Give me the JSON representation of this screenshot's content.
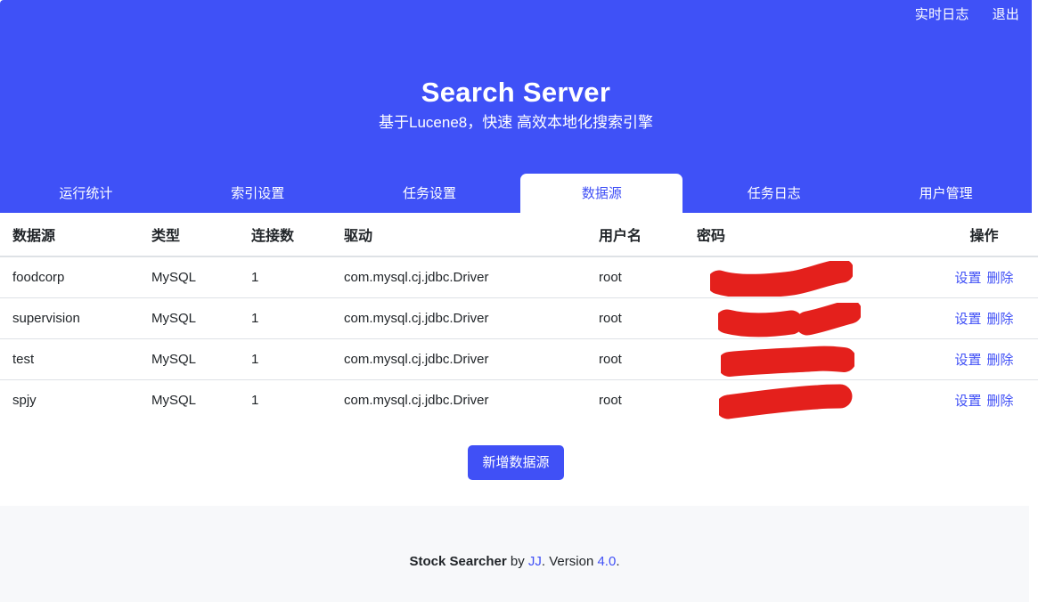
{
  "header": {
    "title": "Search Server",
    "subtitle": "基于Lucene8，快速 高效本地化搜索引擎",
    "accent_color": "#3f51f7",
    "topnav": [
      {
        "label": "实时日志",
        "name": "realtime-log"
      },
      {
        "label": "退出",
        "name": "logout"
      }
    ]
  },
  "tabs": [
    {
      "label": "运行统计",
      "name": "run-stats",
      "active": false
    },
    {
      "label": "索引设置",
      "name": "index-settings",
      "active": false
    },
    {
      "label": "任务设置",
      "name": "task-settings",
      "active": false
    },
    {
      "label": "数据源",
      "name": "datasource",
      "active": true
    },
    {
      "label": "任务日志",
      "name": "task-log",
      "active": false
    },
    {
      "label": "用户管理",
      "name": "user-management",
      "active": false
    }
  ],
  "table": {
    "columns": [
      {
        "key": "datasource",
        "label": "数据源"
      },
      {
        "key": "type",
        "label": "类型"
      },
      {
        "key": "connections",
        "label": "连接数"
      },
      {
        "key": "driver",
        "label": "驱动"
      },
      {
        "key": "username",
        "label": "用户名"
      },
      {
        "key": "password",
        "label": "密码"
      },
      {
        "key": "operations",
        "label": "操作"
      }
    ],
    "rows": [
      {
        "datasource": "foodcorp",
        "type": "MySQL",
        "connections": "1",
        "driver": "com.mysql.cj.jdbc.Driver",
        "username": "root",
        "password": "",
        "password_redacted": true,
        "settings_label": "设置",
        "delete_label": "删除"
      },
      {
        "datasource": "supervision",
        "type": "MySQL",
        "connections": "1",
        "driver": "com.mysql.cj.jdbc.Driver",
        "username": "root",
        "password": "",
        "password_redacted": true,
        "settings_label": "设置",
        "delete_label": "删除"
      },
      {
        "datasource": "test",
        "type": "MySQL",
        "connections": "1",
        "driver": "com.mysql.cj.jdbc.Driver",
        "username": "root",
        "password": "",
        "password_redacted": true,
        "settings_label": "设置",
        "delete_label": "删除"
      },
      {
        "datasource": "spjy",
        "type": "MySQL",
        "connections": "1",
        "driver": "com.mysql.cj.jdbc.Driver",
        "username": "root",
        "password": "",
        "password_redacted": true,
        "settings_label": "设置",
        "delete_label": "删除"
      }
    ],
    "redaction_color": "#e4201c"
  },
  "actions": {
    "add_datasource_label": "新增数据源"
  },
  "footer": {
    "product": "Stock Searcher",
    "by_text": " by ",
    "author": "JJ",
    "version_prefix": ". Version ",
    "version": "4.0",
    "suffix": "."
  }
}
